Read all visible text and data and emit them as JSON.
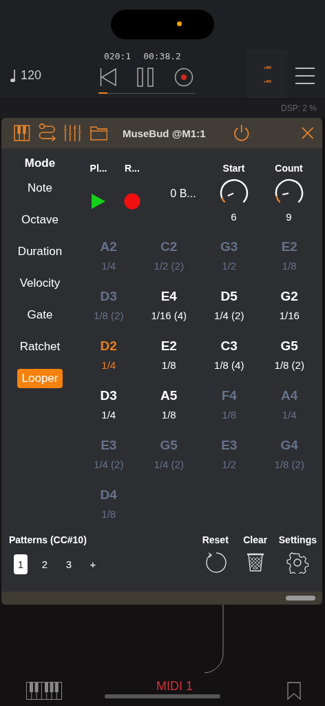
{
  "transport": {
    "tempo": "120",
    "position": "020:1",
    "time": "00:38.2",
    "progress": {
      "level": 0.09
    },
    "meters": [
      "-∞",
      "-∞"
    ]
  },
  "dsp": "DSP: 2 %",
  "plugin": {
    "title": "MuseBud @M1:1",
    "mode_title": "Mode",
    "modes": [
      {
        "label": "Note",
        "selected": false
      },
      {
        "label": "Octave",
        "selected": false
      },
      {
        "label": "Duration",
        "selected": false
      },
      {
        "label": "Velocity",
        "selected": false
      },
      {
        "label": "Gate",
        "selected": false
      },
      {
        "label": "Ratchet",
        "selected": false
      },
      {
        "label": "Looper",
        "selected": true
      }
    ],
    "controls": {
      "play_label": "Pl...",
      "record_label": "R...",
      "bars": "0 B...",
      "knobs": [
        {
          "label": "Start",
          "value": "6",
          "level": 0.08
        },
        {
          "label": "Count",
          "value": "9",
          "level": 0.12
        }
      ]
    },
    "steps": [
      {
        "note": "A2",
        "duration": "1/4",
        "kind": "muted"
      },
      {
        "note": "C2",
        "duration": "1/2 (2)",
        "kind": "muted"
      },
      {
        "note": "G3",
        "duration": "1/2",
        "kind": "muted"
      },
      {
        "note": "E2",
        "duration": "1/8",
        "kind": "muted"
      },
      {
        "note": "D3",
        "duration": "1/8 (2)",
        "kind": "muted"
      },
      {
        "note": "E4",
        "duration": "1/16 (4)",
        "kind": "active"
      },
      {
        "note": "D5",
        "duration": "1/4 (2)",
        "kind": "active"
      },
      {
        "note": "G2",
        "duration": "1/16",
        "kind": "active"
      },
      {
        "note": "D2",
        "duration": "1/4",
        "kind": "current"
      },
      {
        "note": "E2",
        "duration": "1/8",
        "kind": "active"
      },
      {
        "note": "C3",
        "duration": "1/8 (4)",
        "kind": "active"
      },
      {
        "note": "G5",
        "duration": "1/8 (2)",
        "kind": "active"
      },
      {
        "note": "D3",
        "duration": "1/4",
        "kind": "active"
      },
      {
        "note": "A5",
        "duration": "1/8",
        "kind": "active"
      },
      {
        "note": "F4",
        "duration": "1/8",
        "kind": "muted"
      },
      {
        "note": "A4",
        "duration": "1/4",
        "kind": "muted"
      },
      {
        "note": "E3",
        "duration": "1/4 (2)",
        "kind": "muted"
      },
      {
        "note": "G5",
        "duration": "1/4 (2)",
        "kind": "muted"
      },
      {
        "note": "E3",
        "duration": "1/2",
        "kind": "muted"
      },
      {
        "note": "G4",
        "duration": "1/8 (2)",
        "kind": "muted"
      },
      {
        "note": "D4",
        "duration": "1/8",
        "kind": "muted"
      }
    ],
    "patterns": {
      "label": "Patterns (CC#10)",
      "items": [
        {
          "label": "1",
          "selected": true
        },
        {
          "label": "2",
          "selected": false
        },
        {
          "label": "3",
          "selected": false
        }
      ],
      "add": "+"
    },
    "actions": [
      {
        "label": "Reset",
        "kind": "reset"
      },
      {
        "label": "Clear",
        "kind": "clear"
      },
      {
        "label": "Settings",
        "kind": "settings"
      }
    ]
  },
  "bottom_bar": {
    "track": "MIDI 1"
  }
}
